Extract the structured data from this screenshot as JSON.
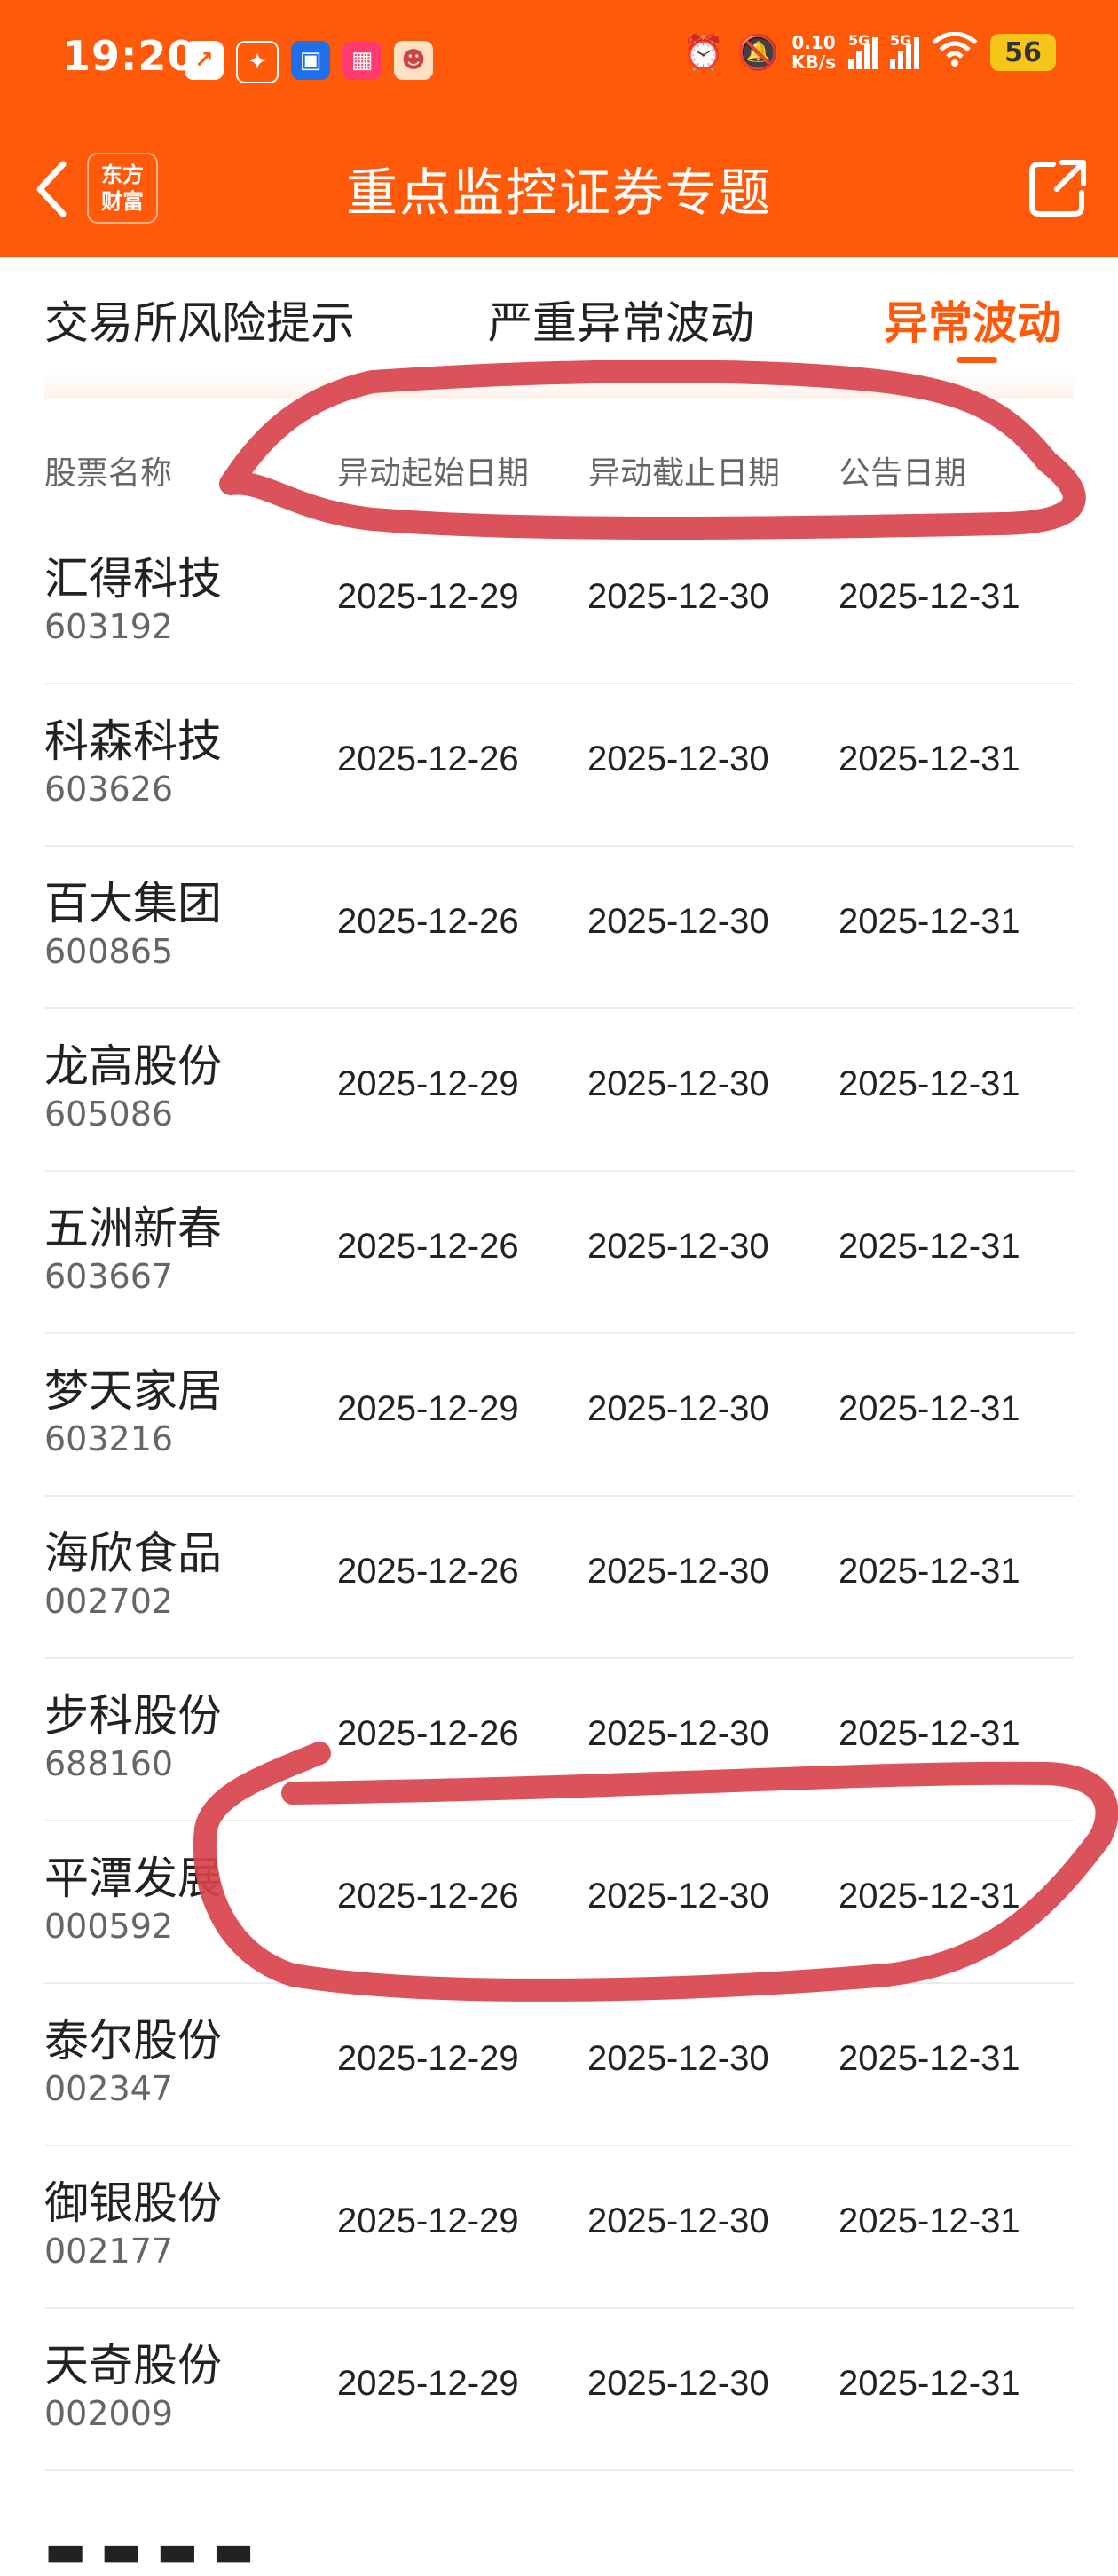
{
  "status_bar": {
    "time": "19:20",
    "app_icons": [
      "stock-app-icon",
      "gift-app-icon",
      "blue-app-icon",
      "grid-app-icon",
      "mascot-app-icon"
    ],
    "net_speed_value": "0.10",
    "net_speed_unit": "KB/s",
    "signal_1_label": "5G",
    "signal_2_label": "5G",
    "battery": "56"
  },
  "nav": {
    "brand_line1": "东方",
    "brand_line2": "财富",
    "title": "重点监控证券专题"
  },
  "tabs": [
    {
      "label": "交易所风险提示",
      "active": false
    },
    {
      "label": "严重异常波动",
      "active": false
    },
    {
      "label": "异常波动",
      "active": true
    }
  ],
  "table": {
    "headers": [
      "股票名称",
      "异动起始日期",
      "异动截止日期",
      "公告日期"
    ],
    "rows": [
      {
        "name": "汇得科技",
        "code": "603192",
        "start": "2025-12-29",
        "end": "2025-12-30",
        "announce": "2025-12-31"
      },
      {
        "name": "科森科技",
        "code": "603626",
        "start": "2025-12-26",
        "end": "2025-12-30",
        "announce": "2025-12-31"
      },
      {
        "name": "百大集团",
        "code": "600865",
        "start": "2025-12-26",
        "end": "2025-12-30",
        "announce": "2025-12-31"
      },
      {
        "name": "龙高股份",
        "code": "605086",
        "start": "2025-12-29",
        "end": "2025-12-30",
        "announce": "2025-12-31"
      },
      {
        "name": "五洲新春",
        "code": "603667",
        "start": "2025-12-26",
        "end": "2025-12-30",
        "announce": "2025-12-31"
      },
      {
        "name": "梦天家居",
        "code": "603216",
        "start": "2025-12-29",
        "end": "2025-12-30",
        "announce": "2025-12-31"
      },
      {
        "name": "海欣食品",
        "code": "002702",
        "start": "2025-12-26",
        "end": "2025-12-30",
        "announce": "2025-12-31"
      },
      {
        "name": "步科股份",
        "code": "688160",
        "start": "2025-12-26",
        "end": "2025-12-30",
        "announce": "2025-12-31"
      },
      {
        "name": "平潭发展",
        "code": "000592",
        "start": "2025-12-26",
        "end": "2025-12-30",
        "announce": "2025-12-31"
      },
      {
        "name": "泰尔股份",
        "code": "002347",
        "start": "2025-12-29",
        "end": "2025-12-30",
        "announce": "2025-12-31"
      },
      {
        "name": "御银股份",
        "code": "002177",
        "start": "2025-12-29",
        "end": "2025-12-30",
        "announce": "2025-12-31"
      },
      {
        "name": "天奇股份",
        "code": "002009",
        "start": "2025-12-29",
        "end": "2025-12-30",
        "announce": "2025-12-31"
      }
    ]
  },
  "colors": {
    "brand": "#ff5a0a",
    "annotation": "#d9434c"
  }
}
